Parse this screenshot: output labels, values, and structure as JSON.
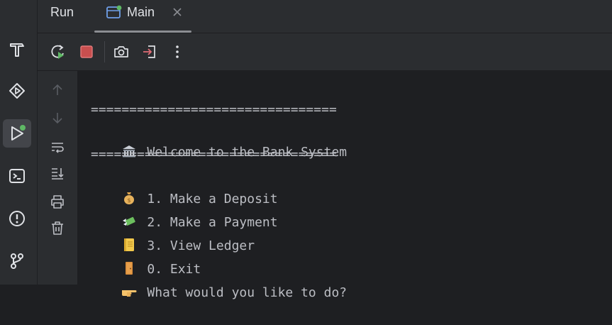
{
  "panel": {
    "title": "Run",
    "tab_label": "Main"
  },
  "icons": {
    "left_strip": [
      "build-hammer-icon",
      "services-icon",
      "run-icon",
      "terminal-icon",
      "problems-icon",
      "git-icon"
    ],
    "toolbar": [
      "rerun-icon",
      "stop-icon",
      "screenshot-icon",
      "exit-icon",
      "more-icon"
    ],
    "gutter": [
      "arrow-up-icon",
      "arrow-down-icon",
      "soft-wrap-icon",
      "scroll-to-end-icon",
      "print-icon",
      "trash-icon"
    ]
  },
  "colors": {
    "accent_green": "#5fb865",
    "stop_red": "#d95f5f",
    "console_text": "#bcbec4"
  },
  "console": {
    "separator_top": "================================",
    "welcome": "Welcome to the Bank System",
    "separator_bottom": "================================",
    "option1": "1. Make a Deposit",
    "option2": "2. Make a Payment",
    "option3": "3. View Ledger",
    "option4": "0. Exit",
    "prompt": "What would you like to do?"
  }
}
